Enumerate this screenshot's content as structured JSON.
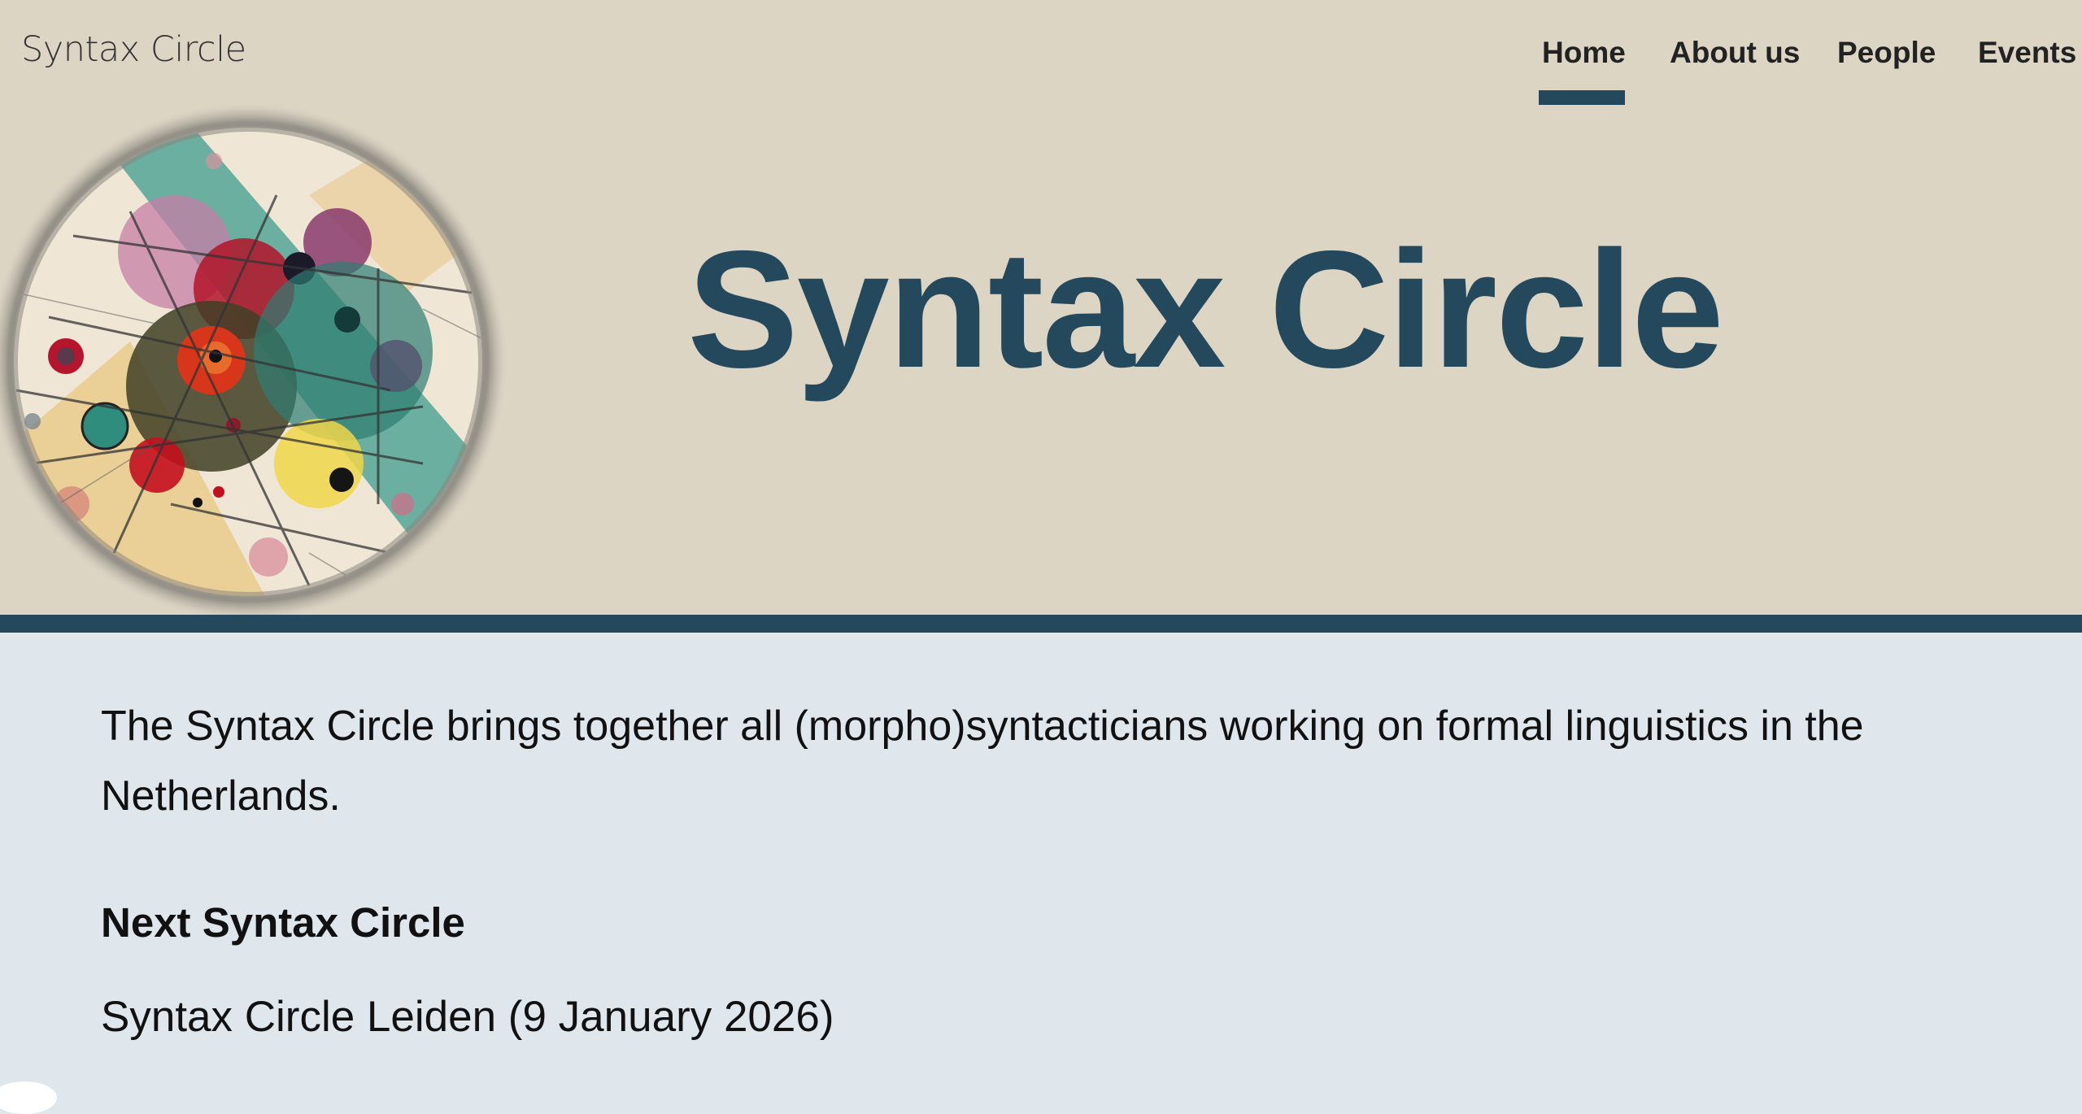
{
  "header": {
    "site_name": "Syntax Circle",
    "hero_title": "Syntax Circle",
    "background_color": "#ddd5c4",
    "accent_color": "#24495c"
  },
  "nav": {
    "items": [
      {
        "label": "Home",
        "active": true
      },
      {
        "label": "About us",
        "active": false
      },
      {
        "label": "People",
        "active": false
      },
      {
        "label": "Events",
        "active": false
      }
    ]
  },
  "main": {
    "intro": "The Syntax Circle brings together all (morpho)syntacticians working on formal linguistics in the Netherlands.",
    "next_heading": "Next Syntax Circle",
    "next_event": "Syntax Circle Leiden (9 January 2026)",
    "background_color": "#e0e7ec"
  },
  "hero_image": {
    "icon": "abstract-circles-artwork"
  }
}
